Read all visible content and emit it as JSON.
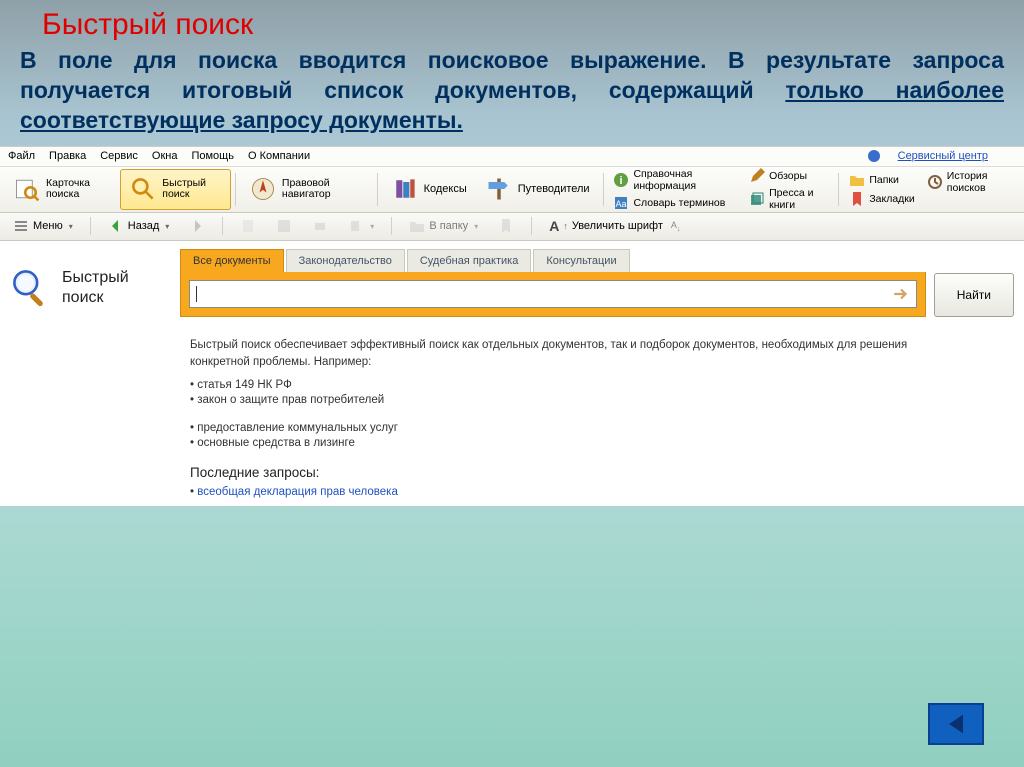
{
  "slide": {
    "title": "Быстрый поиск",
    "body_plain": "В поле для поиска вводится поисковое выражение. В результате запроса получается итоговый список документов, содержащий ",
    "body_underlined": "только наиболее соответствующие запросу документы."
  },
  "menubar": [
    "Файл",
    "Правка",
    "Сервис",
    "Окна",
    "Помощь",
    "О Компании"
  ],
  "service_center": "Сервисный центр",
  "toolbar1": {
    "card_search": "Карточка поиска",
    "quick_search": "Быстрый поиск",
    "legal_nav": "Правовой навигатор",
    "codexes": "Кодексы",
    "guides": "Путеводители",
    "ref_info": "Справочная информация",
    "reviews": "Обзоры",
    "glossary": "Словарь терминов",
    "press": "Пресса и книги",
    "folders": "Папки",
    "history": "История поисков",
    "bookmarks": "Закладки"
  },
  "toolbar2": {
    "menu": "Меню",
    "back": "Назад",
    "infolder": "В папку",
    "enlarge": "Увеличить шрифт"
  },
  "search": {
    "title_l1": "Быстрый",
    "title_l2": "поиск",
    "tabs": [
      "Все документы",
      "Законодательство",
      "Судебная практика",
      "Консультации"
    ],
    "input_value": "",
    "find": "Найти"
  },
  "hint": "Быстрый поиск обеспечивает эффективный поиск как отдельных документов, так и подборок документов, необходимых для решения конкретной проблемы. Например:",
  "examples": [
    "статья 149 НК РФ",
    "закон о защите прав потребителей",
    "предоставление коммунальных услуг",
    "основные средства в лизинге"
  ],
  "recent_title": "Последние запросы:",
  "recent": [
    "всеобщая декларация прав человека"
  ]
}
